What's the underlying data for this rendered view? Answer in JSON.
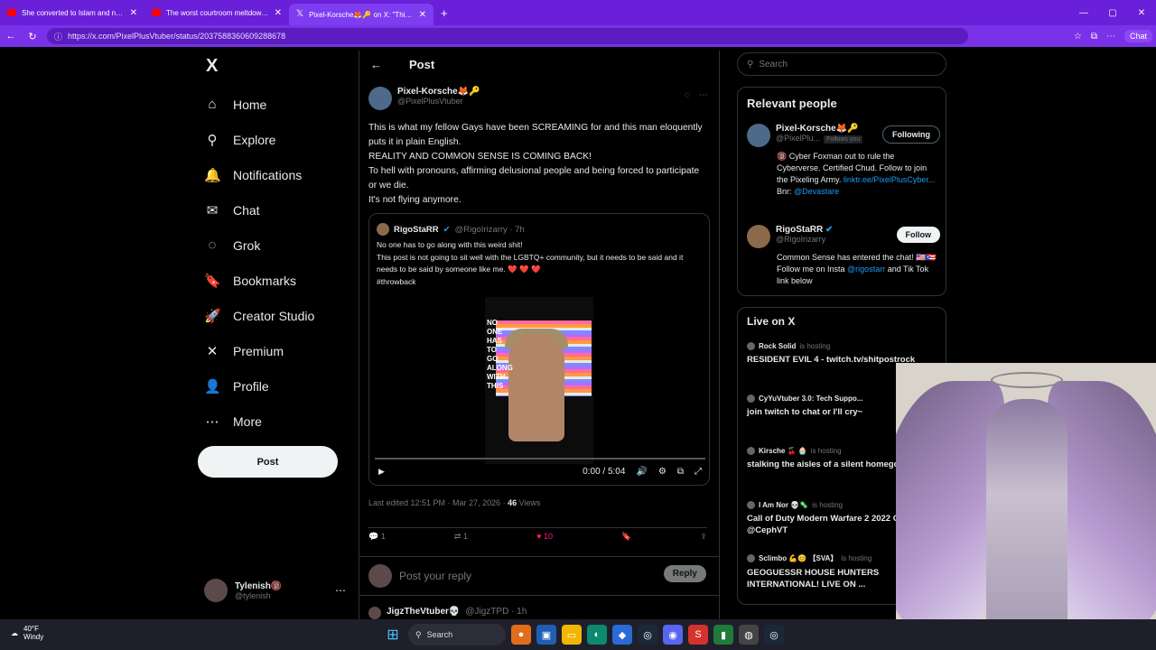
{
  "browser": {
    "tabs": [
      {
        "title": "She converted to Islam and now w",
        "type": "youtube"
      },
      {
        "title": "The worst courtroom meltdown e",
        "type": "youtube"
      },
      {
        "title": "Pixel-Korsche🦊🔑 on X: \"This is w",
        "type": "x",
        "active": true
      }
    ],
    "url": "https://x.com/PixelPlusVtuber/status/2037588360609288678",
    "chat_label": "Chat"
  },
  "sidebar": {
    "logo": "X",
    "items": [
      {
        "label": "Home",
        "icon": "home-icon",
        "glyph": "⌂"
      },
      {
        "label": "Explore",
        "icon": "search-icon",
        "glyph": "⚲"
      },
      {
        "label": "Notifications",
        "icon": "bell-icon",
        "glyph": "🔔"
      },
      {
        "label": "Chat",
        "icon": "mail-icon",
        "glyph": "✉"
      },
      {
        "label": "Grok",
        "icon": "grok-icon",
        "glyph": "◌"
      },
      {
        "label": "Bookmarks",
        "icon": "bookmark-icon",
        "glyph": "🔖"
      },
      {
        "label": "Creator Studio",
        "icon": "rocket-icon",
        "glyph": "🚀"
      },
      {
        "label": "Premium",
        "icon": "x-icon",
        "glyph": "✕"
      },
      {
        "label": "Profile",
        "icon": "person-icon",
        "glyph": "👤"
      },
      {
        "label": "More",
        "icon": "more-icon",
        "glyph": "⋯"
      }
    ],
    "post_button": "Post",
    "user": {
      "name": "Tylenish🔞",
      "handle": "@tylenish"
    }
  },
  "post": {
    "header": "Post",
    "author_name": "Pixel-Korsche🦊🔑",
    "author_handle": "@PixelPlusVtuber",
    "lines": [
      "This is what my fellow Gays have been SCREAMING for and this man eloquently puts it in plain English.",
      "REALITY AND COMMON SENSE IS COMING BACK!",
      "To hell with pronouns, affirming delusional people and being forced to participate or we die.",
      "It's not flying anymore."
    ],
    "quote": {
      "author_name": "RigoStaRR",
      "author_handle": "@RigoIrizarry · 7h",
      "lines": [
        "No one has to go along with this weird shit!",
        "This post is not going to sit well with the LGBTQ+ community, but it needs to be said and it needs to be said by someone like me. ❤️ ❤️ ❤️",
        "#throwback"
      ],
      "video_text": "NO ONE HAS TO GO ALONG WITH THIS",
      "time": "0:00 / 5:04"
    },
    "edited": "Last edited 12:51 PM · Mar 27, 2026 · ",
    "views_count": "46",
    "views_label": " Views",
    "replies": "1",
    "reposts": "1",
    "likes": "10",
    "reply_placeholder": "Post your reply",
    "reply_button": "Reply",
    "next_author": "JigzTheVtuber💀",
    "next_handle": "@JigzTPD · 1h"
  },
  "right": {
    "search_placeholder": "Search",
    "relevant_title": "Relevant people",
    "people": [
      {
        "name": "Pixel-Korsche🦊🔑",
        "handle": "@PixelPlu...",
        "follows_you": "Follows you",
        "bio": "🔞 Cyber Foxman out to rule the Cyberverse. Certified Chud. Follow to join the Pixeling Army.",
        "link": "linktr.ee/PixelPlusCyber...",
        "bio2": " Bnr: ",
        "mention": "@Devastare",
        "button": "Following"
      },
      {
        "name": "RigoStaRR",
        "handle": "@RigoIrizarry",
        "bio": "Common Sense has entered the chat! 🇺🇸🇵🇷 Follow me on Insta ",
        "mention": "@rigostarr",
        "bio2": " and Tik Tok link below",
        "button": "Follow"
      }
    ],
    "live_title": "Live on X",
    "live": [
      {
        "host": "Rock Solid",
        "status": "is hosting",
        "title": "RESIDENT EVIL 4 - twitch.tv/shitpostrock"
      },
      {
        "host": "CyYuVtuber 3.0: Tech Suppo...",
        "status": "",
        "title": "join twitch to chat or I'll cry~"
      },
      {
        "host": "Kirsche 🍒 🧁",
        "status": "is hosting",
        "title": "stalking the aisles of a silent homegood's store"
      },
      {
        "host": "I Am Nor 💀🦠",
        "status": "is hosting",
        "title": "Call of Duty Modern Warfare 2 2022 Co-Op with @CephVT"
      },
      {
        "host": "Sclimbo 💪😊 【SVA】",
        "status": "is hosting",
        "title": "GEOGUESSR HOUSE HUNTERS INTERNATIONAL! LIVE ON ..."
      }
    ]
  },
  "taskbar": {
    "temp": "40°F",
    "condition": "Windy",
    "search": "Search"
  }
}
